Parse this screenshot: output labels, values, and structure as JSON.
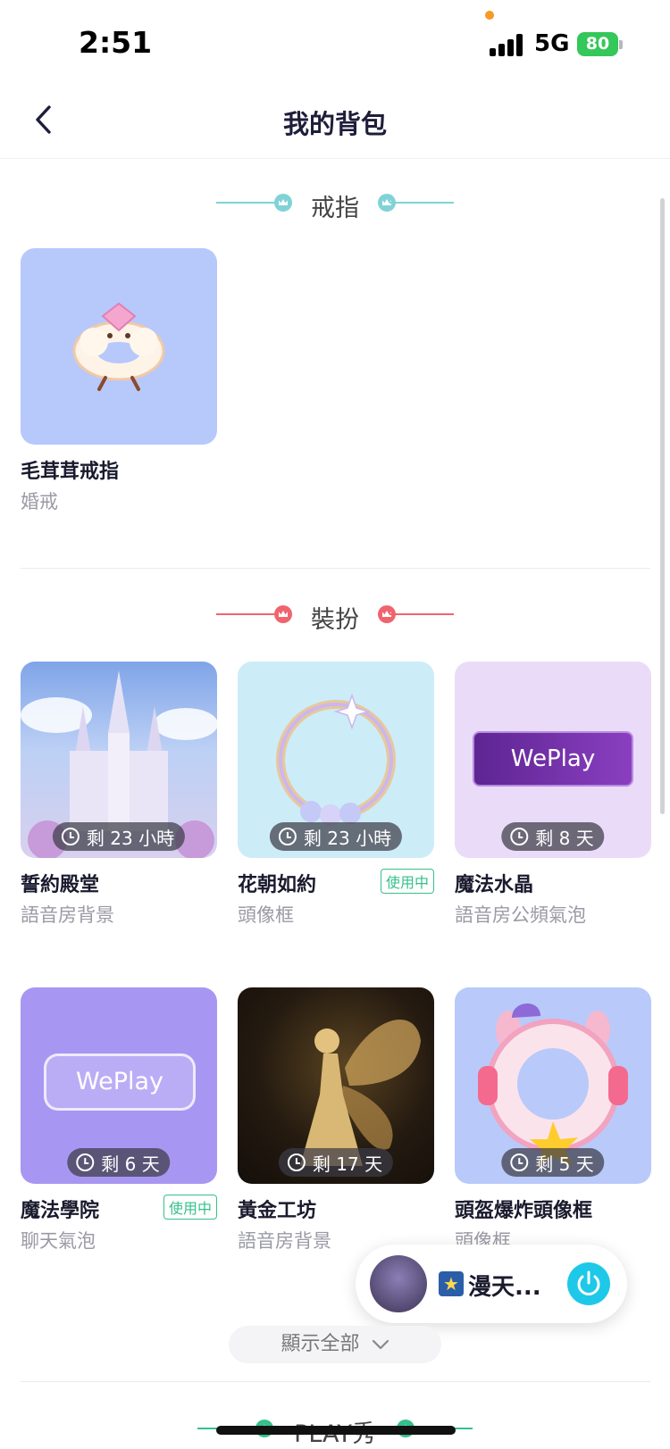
{
  "status_bar": {
    "time": "2:51",
    "network": "5G",
    "battery": "80"
  },
  "header": {
    "title": "我的背包"
  },
  "sections": {
    "rings": {
      "title": "戒指",
      "accent": "#7fd3d6"
    },
    "dressup": {
      "title": "裝扮",
      "accent": "#f0646e"
    },
    "play": {
      "title": "PLAY秀",
      "accent": "#36c08a"
    }
  },
  "ring_items": [
    {
      "name": "毛茸茸戒指",
      "category": "婚戒"
    }
  ],
  "dressup_items": [
    {
      "name": "誓約殿堂",
      "category": "語音房背景",
      "timer": "剩 23 小時",
      "in_use": ""
    },
    {
      "name": "花朝如約",
      "category": "頭像框",
      "timer": "剩 23 小時",
      "in_use": "使用中"
    },
    {
      "name": "魔法水晶",
      "category": "語音房公頻氣泡",
      "timer": "剩 8 天",
      "in_use": "",
      "preview_text": "WePlay"
    },
    {
      "name": "魔法學院",
      "category": "聊天氣泡",
      "timer": "剩 6 天",
      "in_use": "使用中",
      "preview_text": "WePlay"
    },
    {
      "name": "黃金工坊",
      "category": "語音房背景",
      "timer": "剩 17 天",
      "in_use": ""
    },
    {
      "name": "頭盔爆炸頭像框",
      "category": "頭像框",
      "timer": "剩 5 天",
      "in_use": ""
    }
  ],
  "show_all": {
    "label": "顯示全部"
  },
  "player": {
    "title": "漫天..."
  },
  "colors": {
    "in_use": "#36c08a",
    "power_button": "#1ec8e8"
  }
}
